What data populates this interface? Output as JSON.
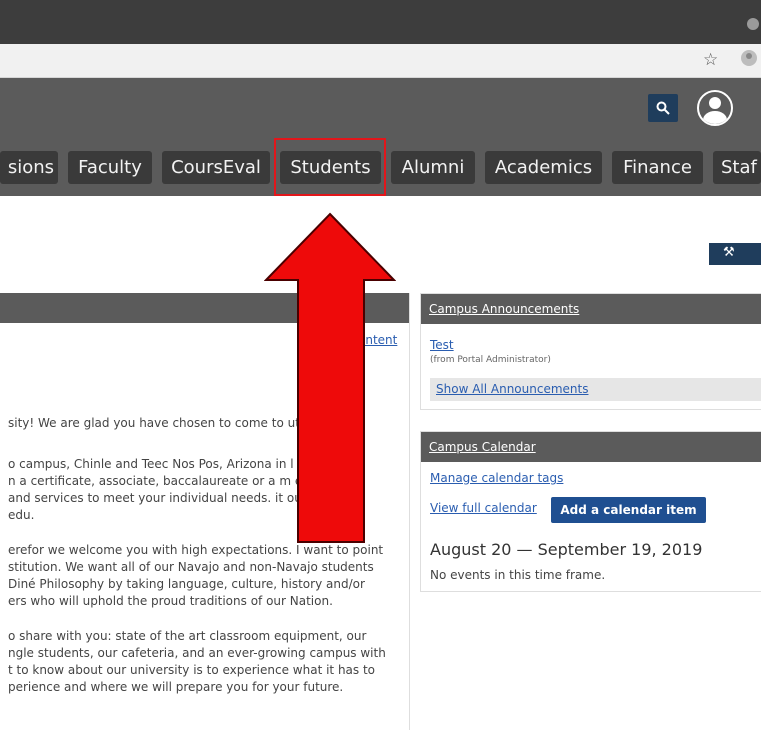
{
  "browser": {
    "bookmark_icon": "star-icon",
    "profile_icon": "person-icon"
  },
  "header": {
    "search_icon": "search-icon",
    "avatar_icon": "user-icon"
  },
  "nav": {
    "tabs": [
      {
        "label": "sions"
      },
      {
        "label": "Faculty"
      },
      {
        "label": "CoursEval"
      },
      {
        "label": "Students"
      },
      {
        "label": "Alumni"
      },
      {
        "label": "Academics"
      },
      {
        "label": "Finance"
      },
      {
        "label": "Staf"
      }
    ]
  },
  "annotation": {
    "highlight_color": "#e2161b",
    "arrow_color": "#ee0a0a",
    "highlighted_tab": "Students"
  },
  "toolbar": {
    "tools_icon": "wrench-icon"
  },
  "welcome": {
    "content_link": "ontent",
    "paragraphs": [
      [
        "sity!  We are glad you have chosen to come to                  ution."
      ],
      [
        "o campus, Chinle and Teec Nos Pos, Arizona in                  l sites",
        "n a certificate, associate, baccalaureate or a m              egree.",
        " and services to meet your individual needs.              it our",
        "edu."
      ],
      [
        "erefor we welcome you with high expectations. I want to point",
        "stitution. We want all of our Navajo and non-Navajo students",
        " Diné Philosophy by taking language, culture, history and/or",
        "ers who will uphold the proud traditions of our Nation."
      ],
      [
        "o share with you: state of the art classroom equipment, our",
        "ngle students, our cafeteria, and an ever-growing campus with",
        "t to know about our university is to experience what it has to",
        "perience and where we will prepare you for your future."
      ]
    ]
  },
  "announcements": {
    "title": "Campus Announcements",
    "item_title": "Test",
    "item_from": "(from Portal Administrator)",
    "show_all": "Show All Announcements"
  },
  "calendar": {
    "title": "Campus Calendar",
    "manage_tags": "Manage calendar tags",
    "view_full": "View full calendar",
    "add_item": "Add a calendar item",
    "date_range": "August 20 — September 19, 2019",
    "no_events": "No events in this time frame."
  }
}
